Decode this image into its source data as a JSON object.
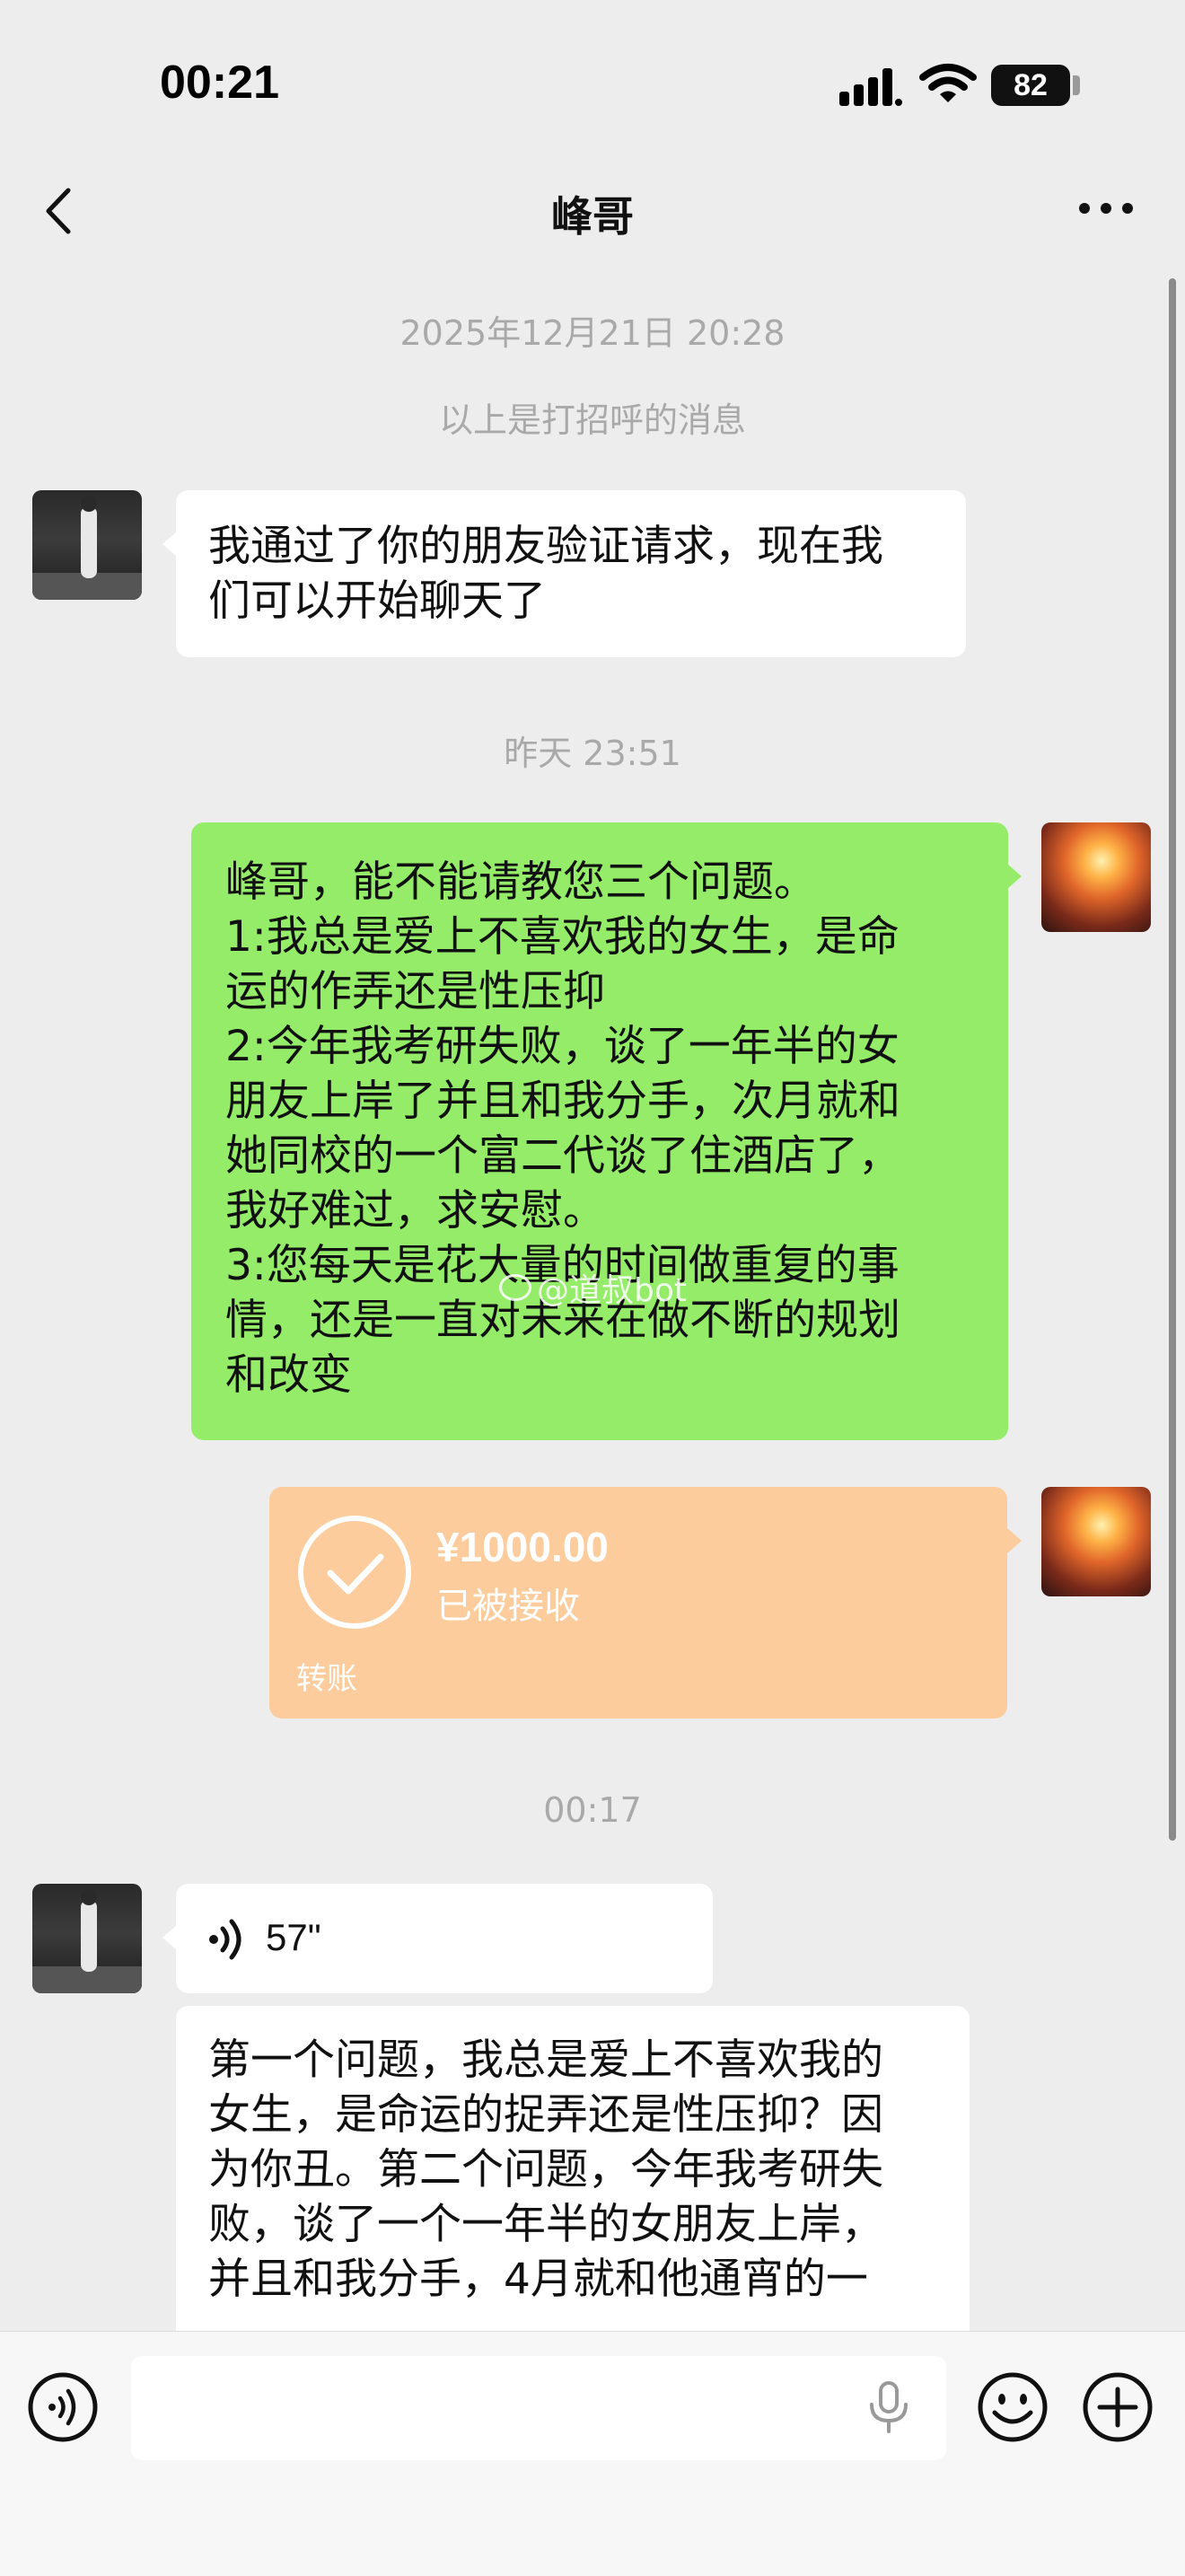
{
  "status_bar": {
    "time": "00:21",
    "battery_level": "82"
  },
  "header": {
    "title": "峰哥",
    "back_icon": "chevron-left-icon",
    "more_icon": "more-dots-icon"
  },
  "messages": {
    "timestamp_1": "2025年12月21日 20:28",
    "system_notice": "以上是打招呼的消息",
    "msg_1": "我通过了你的朋友验证请求，现在我\n们可以开始聊天了",
    "timestamp_2": "昨天 23:51",
    "msg_2": "峰哥，能不能请教您三个问题。\n1:我总是爱上不喜欢我的女生，是命\n运的作弄还是性压抑\n2:今年我考研失败，谈了一年半的女\n朋友上岸了并且和我分手，次月就和\n她同校的一个富二代谈了住酒店了，\n我好难过，求安慰。\n3:您每天是花大量的时间做重复的事\n情，还是一直对未来在做不断的规划\n和改变",
    "transfer": {
      "amount": "¥1000.00",
      "status": "已被接收",
      "label": "转账"
    },
    "timestamp_3": "00:17",
    "voice": {
      "duration": "57\""
    },
    "msg_3": "第一个问题，我总是爱上不喜欢我的\n女生，是命运的捉弄还是性压抑？因\n为你丑。第二个问题，今年我考研失\n败，谈了一个一年半的女朋友上岸，\n并且和我分手，4月就和他通宵的一"
  },
  "watermark": "@道叔bot",
  "input_bar": {
    "placeholder": ""
  },
  "colors": {
    "background": "#ededed",
    "sent_bubble": "#95ec69",
    "received_bubble": "#ffffff",
    "transfer_card": "#fccc9c"
  }
}
